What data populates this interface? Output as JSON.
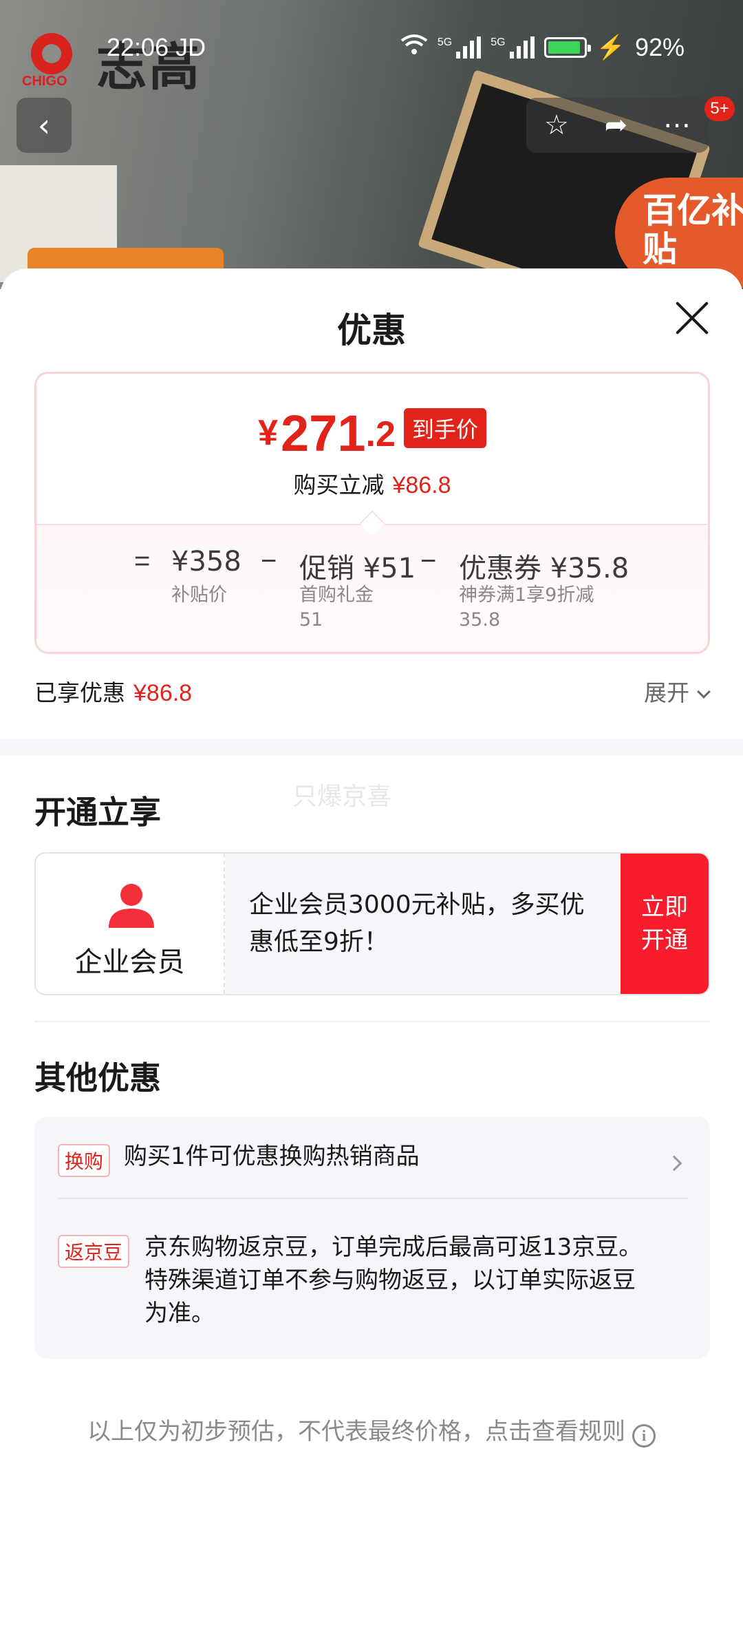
{
  "status_bar": {
    "time": "22:06",
    "carrier": "JD",
    "network1": "5G",
    "network2": "5G",
    "battery": "92%"
  },
  "background": {
    "brand_logo_text": "志高",
    "brand_small": "CHIGO",
    "badge_text": "百亿补贴",
    "cart_count": "5+"
  },
  "sheet": {
    "title": "优惠",
    "price": {
      "yen": "¥",
      "integer": "271",
      "decimal": ".2",
      "tag": "到手价",
      "reduce_label": "购买立减",
      "reduce_value": "¥86.8"
    },
    "formula": {
      "eq": "=",
      "minus1": "−",
      "minus2": "−",
      "base_value": "¥358",
      "base_label": "补贴价",
      "promo_value": "促销 ¥51",
      "promo_label_line1": "首购礼金",
      "promo_label_line2": "51",
      "coupon_value": "优惠券 ¥35.8",
      "coupon_label_line1": "神券满1享9折减",
      "coupon_label_line2": "35.8"
    },
    "enjoyed_label": "已享优惠",
    "enjoyed_value": "¥86.8",
    "expand_label": "展开",
    "open_section_title": "开通立享",
    "watermark": "只爆京喜",
    "member": {
      "label": "企业会员",
      "text": "企业会员3000元补贴，多买优惠低至9折！",
      "button_line1": "立即",
      "button_line2": "开通"
    },
    "other_section_title": "其他优惠",
    "other_items": [
      {
        "badge": "换购",
        "text": "购买1件可优惠换购热销商品"
      },
      {
        "badge": "返京豆",
        "text": "京东购物返京豆，订单完成后最高可返13京豆。特殊渠道订单不参与购物返豆，以订单实际返豆为准。"
      }
    ],
    "footer_note": "以上仅为初步预估，不代表最终价格，点击查看规则"
  },
  "colors": {
    "accent_red": "#e2231a",
    "button_red": "#f81c2c",
    "panel_bg": "#f5f6fa"
  }
}
